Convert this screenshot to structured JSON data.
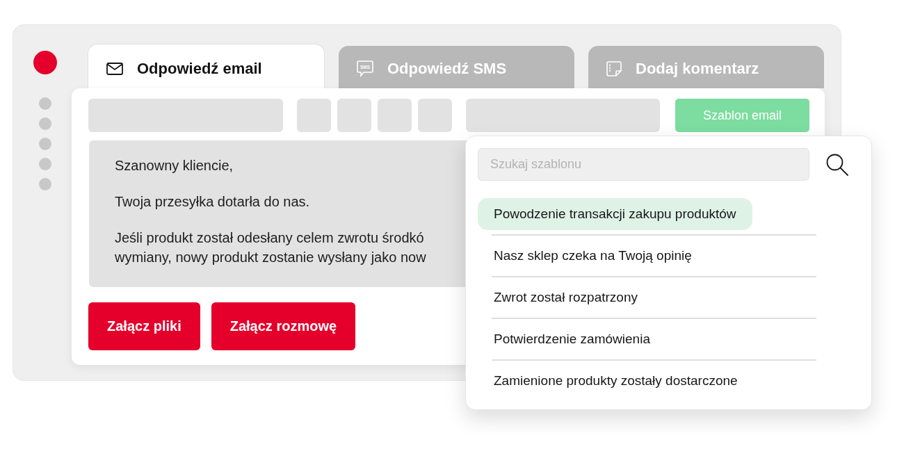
{
  "tabs": [
    {
      "label": "Odpowiedź email",
      "selected": true
    },
    {
      "label": "Odpowiedź SMS",
      "selected": false,
      "icon_label": "SMS"
    },
    {
      "label": "Dodaj komentarz",
      "selected": false
    }
  ],
  "toolbar": {
    "template_button": "Szablon email"
  },
  "editor": {
    "paragraphs": [
      [
        "Szanowny kliencie,"
      ],
      [
        "Twoja przesyłka dotarła do nas."
      ],
      [
        "Jeśli produkt został odesłany celem zwrotu środkó",
        "wymiany, nowy produkt zostanie wysłany jako now"
      ]
    ]
  },
  "buttons": [
    "Załącz pliki",
    "Załącz rozmowę"
  ],
  "template_dropdown": {
    "search": {
      "placeholder": "Szukaj szablonu"
    },
    "items": [
      {
        "label": "Powodzenie transakcji zakupu produktów",
        "selected": true
      },
      {
        "label": "Nasz sklep czeka na Twoją opinię",
        "selected": false
      },
      {
        "label": "Zwrot został rozpatrzony",
        "selected": false
      },
      {
        "label": "Potwierdzenie zamówienia",
        "selected": false
      },
      {
        "label": "Zamienione produkty zostały dostarczone",
        "selected": false
      }
    ]
  }
}
